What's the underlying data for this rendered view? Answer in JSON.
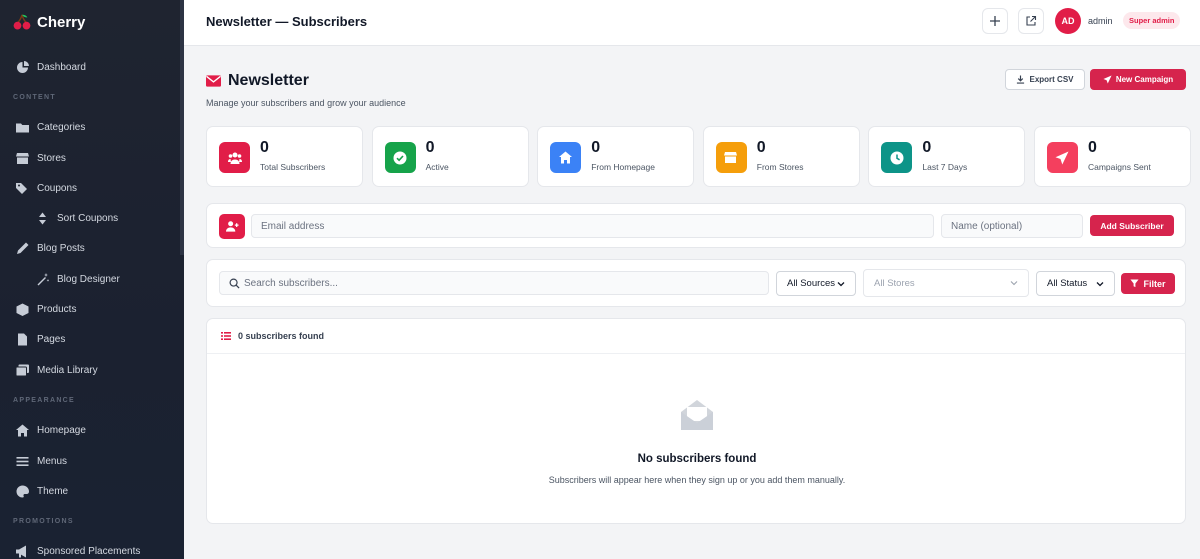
{
  "app": {
    "name": "Cherry",
    "icon": "cherry-icon"
  },
  "sidebar": {
    "items": [
      {
        "type": "item",
        "label": "Dashboard",
        "icon": "dashboard-icon"
      },
      {
        "type": "section",
        "label": "CONTENT"
      },
      {
        "type": "item",
        "label": "Categories",
        "icon": "folder-icon"
      },
      {
        "type": "item",
        "label": "Stores",
        "icon": "store-icon"
      },
      {
        "type": "item",
        "label": "Coupons",
        "icon": "tags-icon"
      },
      {
        "type": "sub",
        "label": "Sort Coupons",
        "icon": "sort-icon"
      },
      {
        "type": "item",
        "label": "Blog Posts",
        "icon": "pen-icon"
      },
      {
        "type": "sub",
        "label": "Blog Designer",
        "icon": "magic-wand-icon"
      },
      {
        "type": "item",
        "label": "Products",
        "icon": "box-icon"
      },
      {
        "type": "item",
        "label": "Pages",
        "icon": "file-icon"
      },
      {
        "type": "item",
        "label": "Media Library",
        "icon": "images-icon"
      },
      {
        "type": "section",
        "label": "APPEARANCE"
      },
      {
        "type": "item",
        "label": "Homepage",
        "icon": "home-icon"
      },
      {
        "type": "item",
        "label": "Menus",
        "icon": "bars-icon"
      },
      {
        "type": "item",
        "label": "Theme",
        "icon": "palette-icon"
      },
      {
        "type": "section",
        "label": "PROMOTIONS"
      },
      {
        "type": "item",
        "label": "Sponsored Placements",
        "icon": "megaphone-icon"
      }
    ]
  },
  "header": {
    "title": "Newsletter — Subscribers",
    "user": {
      "initials": "AD",
      "name": "admin",
      "role": "Super admin"
    }
  },
  "page": {
    "title": "Newsletter",
    "subtitle": "Manage your subscribers and grow your audience",
    "export_label": "Export CSV",
    "campaign_label": "New Campaign"
  },
  "stats": [
    {
      "value": "0",
      "label": "Total Subscribers",
      "color": "#e11d48",
      "icon": "users-icon"
    },
    {
      "value": "0",
      "label": "Active",
      "color": "#16a34a",
      "icon": "check-circle-icon"
    },
    {
      "value": "0",
      "label": "From Homepage",
      "color": "#3b82f6",
      "icon": "home-icon"
    },
    {
      "value": "0",
      "label": "From Stores",
      "color": "#f59e0b",
      "icon": "store-icon"
    },
    {
      "value": "0",
      "label": "Last 7 Days",
      "color": "#0d9488",
      "icon": "clock-icon"
    },
    {
      "value": "0",
      "label": "Campaigns Sent",
      "color": "#f43f5e",
      "icon": "paper-plane-icon"
    }
  ],
  "add_form": {
    "email_placeholder": "Email address",
    "name_placeholder": "Name (optional)",
    "submit_label": "Add Subscriber"
  },
  "filters": {
    "search_placeholder": "Search subscribers...",
    "source": "All Sources",
    "store": "All Stores",
    "status": "All Status",
    "filter_label": "Filter"
  },
  "list": {
    "count_label": "0 subscribers found",
    "empty_title": "No subscribers found",
    "empty_sub": "Subscribers will appear here when they sign up or you add them manually."
  },
  "colors": {
    "accent": "#d6244d",
    "sidebar_bg": "#1f2430"
  }
}
